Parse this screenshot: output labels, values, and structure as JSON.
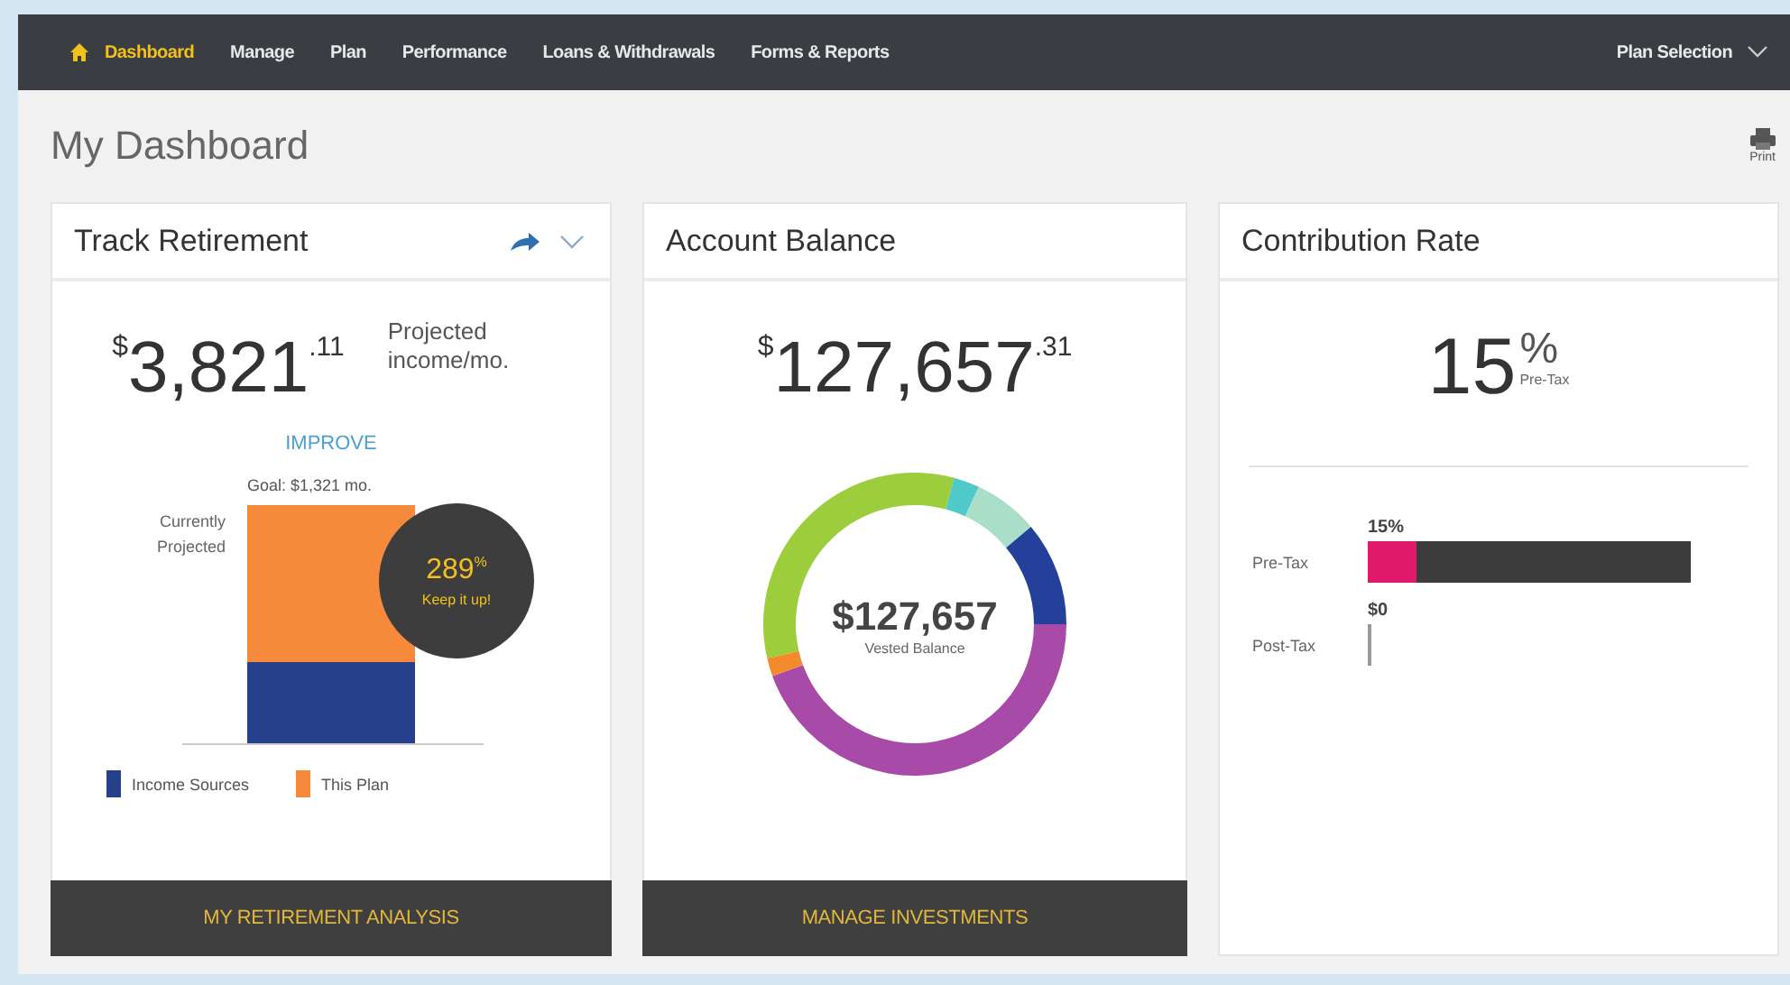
{
  "nav": {
    "items": [
      {
        "label": "Dashboard",
        "selected": true
      },
      {
        "label": "Manage",
        "selected": false
      },
      {
        "label": "Plan",
        "selected": false
      },
      {
        "label": "Performance",
        "selected": false
      },
      {
        "label": "Loans & Withdrawals",
        "selected": false
      },
      {
        "label": "Forms & Reports",
        "selected": false
      }
    ],
    "plan_selection": "Plan Selection"
  },
  "page_title": "My Dashboard",
  "print": "Print",
  "track_retirement": {
    "title": "Track Retirement",
    "amount": {
      "symbol": "$",
      "whole": "3,821",
      "cents": ".11"
    },
    "amount_label": "Projected income/mo.",
    "improve": "IMPROVE",
    "goal": "Goal: $1,321 mo.",
    "current_label": "Currently Projected",
    "badge_value": "289",
    "badge_unit": "%",
    "badge_text": "Keep it up!",
    "legend": [
      {
        "label": "Income Sources",
        "color": "#27408b"
      },
      {
        "label": "This Plan",
        "color": "#f58a3c"
      }
    ],
    "button": "MY RETIREMENT ANALYSIS"
  },
  "account_balance": {
    "title": "Account Balance",
    "amount": {
      "symbol": "$",
      "whole": "127,657",
      "cents": ".31"
    },
    "center_value": "$127,657",
    "center_label": "Vested Balance",
    "button": "MANAGE INVESTMENTS"
  },
  "contribution_rate": {
    "title": "Contribution Rate",
    "rate": "15",
    "unit": "%",
    "rate_label": "Pre-Tax",
    "rows": [
      {
        "label": "Pre-Tax",
        "value": "15%",
        "kind": "bar",
        "level": 0.15
      },
      {
        "label": "Post-Tax",
        "value": "$0",
        "kind": "empty"
      }
    ]
  }
}
